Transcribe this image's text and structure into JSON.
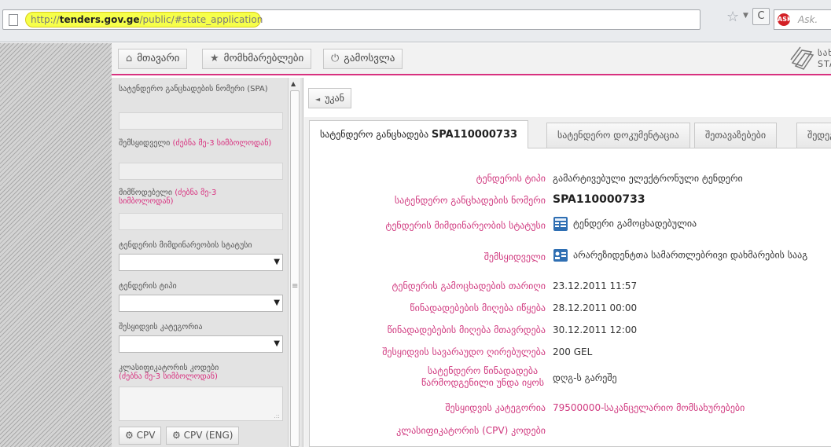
{
  "browser": {
    "url_scheme": "http://",
    "url_host": "tenders.gov.ge",
    "url_path": "/public/#state_application",
    "search_placeholder": "Ask.",
    "search_engine_logo": "ask"
  },
  "topnav": {
    "home_label": "მთავარი",
    "services_label": "მომხმარებლები",
    "logout_label": "გამოსვლა",
    "logo_line1": "სახელ",
    "logo_line2": "STAT"
  },
  "sidebar": {
    "spa_label": "სატენდერო განცხადების ნომერი (SPA)",
    "buyer_label": "შემსყიდველი",
    "buyer_hint": "(ძებნა მე-3 სიმბოლოდან)",
    "supplier_label": "მიმწოდებელი",
    "supplier_hint": "(ძებნა მე-3 სიმბოლოდან)",
    "status_label": "ტენდერის მიმდინარეობის სტატუსი",
    "type_label": "ტენდერის ტიპი",
    "category_label": "შესყიდვის კატეგორია",
    "classifier_label": "კლასიფიკატორის კოდები",
    "classifier_hint": "(ძებნა მე-3 სიმბოლოდან)",
    "cpv_button": "CPV",
    "cpv_eng_button": "CPV (ENG)"
  },
  "main": {
    "back_label": "უკან",
    "tabs": [
      {
        "label": "სატენდერო განცხადება ",
        "bold": "SPA110000733"
      },
      {
        "label": "სატენდერო დოკუმენტაცია"
      },
      {
        "label": "შეთავაზებები"
      },
      {
        "label": "შედეგ"
      }
    ],
    "details": [
      {
        "label": "ტენდერის ტიპი",
        "value": "გამარტივებული ელექტრონული ტენდერი"
      },
      {
        "label": "სატენდერო განცხადების ნომერი",
        "value": "SPA110000733"
      },
      {
        "label": "ტენდერის მიმდინარეობის სტატუსი",
        "value": "ტენდერი გამოცხადებულია"
      },
      {
        "label": "შემსყიდველი",
        "value": "არარეზიდენტთა სამართლებრივი დახმარების სააგ"
      },
      {
        "label": "ტენდერის გამოცხადების თარიღი",
        "value": "23.12.2011 11:57"
      },
      {
        "label": "წინადადებების მიღება იწყება",
        "value": "28.12.2011 00:00"
      },
      {
        "label": "წინადადებების მიღება მთავრდება",
        "value": "30.12.2011 12:00"
      },
      {
        "label": "შესყიდვის სავარაუდო ღირებულება",
        "value": "200 GEL"
      },
      {
        "label": "სატენდერო წინადადება წარმოდგენილი უნდა იყოს",
        "value": "დღგ-ს გარეშე"
      },
      {
        "label": "შესყიდვის კატეგორია",
        "value": "79500000-საკანცელარიო მომსახურებები"
      },
      {
        "label": "კლასიფიკატორის (CPV) კოდები",
        "value": ""
      }
    ]
  },
  "colors": {
    "accent": "#d8317f",
    "url_highlight": "#f6ff4a",
    "panel_bg": "#f0f0f0"
  },
  "icons": [
    "page-icon",
    "star-icon",
    "reload-icon",
    "home-icon",
    "star-icon",
    "power-icon",
    "logo-icon",
    "scroll-up-icon",
    "caret-down-icon",
    "back-arrow-icon",
    "status-icon",
    "buyer-icon"
  ]
}
